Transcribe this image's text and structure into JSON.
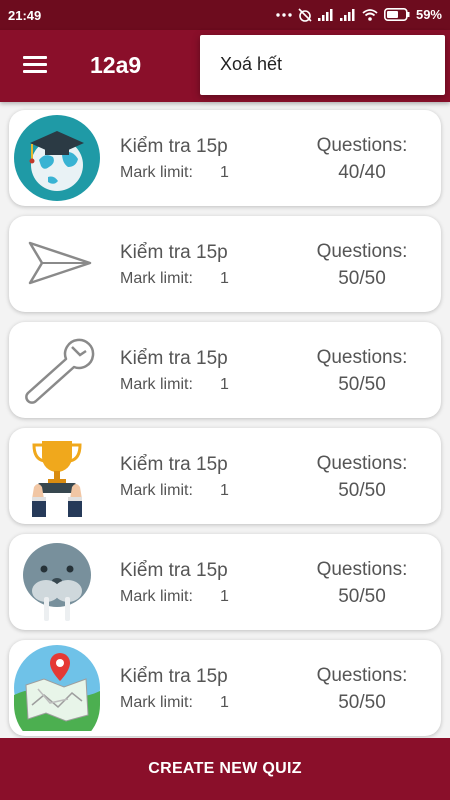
{
  "status_bar": {
    "time": "21:49",
    "battery": "59%"
  },
  "app_bar": {
    "title": "12a9"
  },
  "overflow_menu": {
    "items": [
      "Xoá hết"
    ]
  },
  "quizzes": [
    {
      "title": "Kiểm tra 15p",
      "mark_label": "Mark limit:",
      "mark_value": "1",
      "questions_label": "Questions:",
      "questions_value": "40/40",
      "icon": "graduation-globe-icon"
    },
    {
      "title": "Kiểm tra 15p",
      "mark_label": "Mark limit:",
      "mark_value": "1",
      "questions_label": "Questions:",
      "questions_value": "50/50",
      "icon": "paper-plane-icon"
    },
    {
      "title": "Kiểm tra 15p",
      "mark_label": "Mark limit:",
      "mark_value": "1",
      "questions_label": "Questions:",
      "questions_value": "50/50",
      "icon": "wrench-icon"
    },
    {
      "title": "Kiểm tra 15p",
      "mark_label": "Mark limit:",
      "mark_value": "1",
      "questions_label": "Questions:",
      "questions_value": "50/50",
      "icon": "trophy-icon"
    },
    {
      "title": "Kiểm tra 15p",
      "mark_label": "Mark limit:",
      "mark_value": "1",
      "questions_label": "Questions:",
      "questions_value": "50/50",
      "icon": "walrus-icon"
    },
    {
      "title": "Kiểm tra 15p",
      "mark_label": "Mark limit:",
      "mark_value": "1",
      "questions_label": "Questions:",
      "questions_value": "50/50",
      "icon": "map-pin-icon"
    }
  ],
  "footer": {
    "create_label": "CREATE NEW QUIZ"
  },
  "colors": {
    "primary": "#8a0f2a",
    "status_bar": "#6d0c1e",
    "card_bg": "#ffffff",
    "text": "#555555"
  }
}
